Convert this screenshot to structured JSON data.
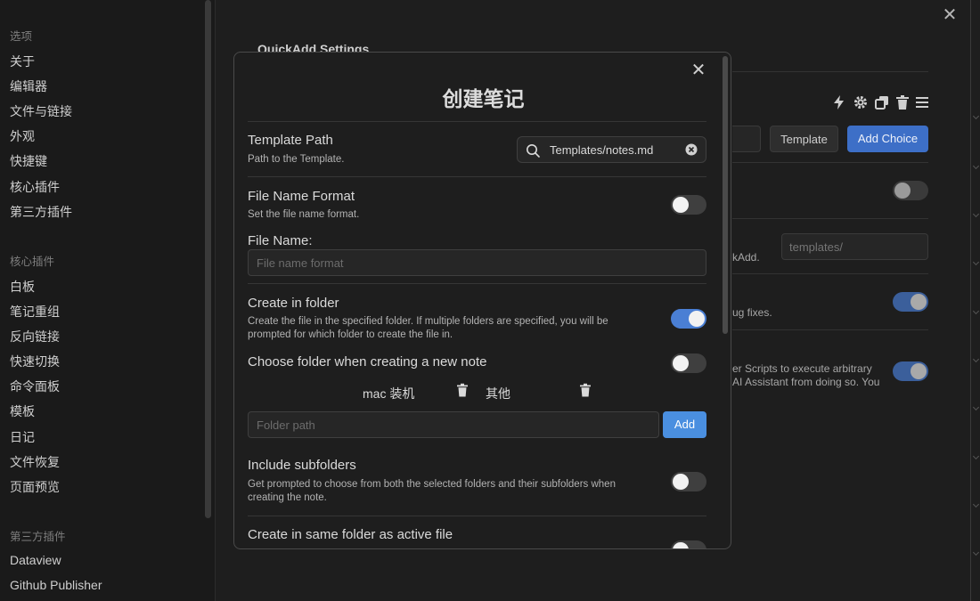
{
  "sidebar": {
    "options_heading": "选项",
    "options_items": [
      "关于",
      "编辑器",
      "文件与链接",
      "外观",
      "快捷键",
      "核心插件",
      "第三方插件"
    ],
    "core_heading": "核心插件",
    "core_items": [
      "白板",
      "笔记重组",
      "反向链接",
      "快速切换",
      "命令面板",
      "模板",
      "日记",
      "文件恢复",
      "页面预览"
    ],
    "third_heading": "第三方插件",
    "third_items": [
      "Dataview",
      "Github Publisher"
    ]
  },
  "background": {
    "title": "QuickAdd Settings",
    "template_button": "Template",
    "add_choice_button": "Add Choice",
    "templates_placeholder": "templates/",
    "frag_quickadd": "kAdd.",
    "frag_bugfixes": "ug fixes.",
    "frag_scripts_1": "er Scripts to execute arbitrary",
    "frag_scripts_2": "AI Assistant from doing so. You",
    "icons": [
      "lightning-icon",
      "gear-icon",
      "duplicate-icon",
      "trash-icon",
      "menu-icon"
    ],
    "toggles": [
      false,
      true,
      true
    ]
  },
  "modal": {
    "title": "创建笔记",
    "template_path": {
      "name": "Template Path",
      "desc": "Path to the Template.",
      "value": "Templates/notes.md"
    },
    "file_name_format": {
      "name": "File Name Format",
      "desc": "Set the file name format.",
      "enabled": false
    },
    "file_name": {
      "label": "File Name:",
      "placeholder": "File name format"
    },
    "create_in_folder": {
      "name": "Create in folder",
      "desc": "Create the file in the specified folder. If multiple folders are specified, you will be prompted for which folder to create the file in.",
      "enabled": true
    },
    "choose_folder": {
      "name": "Choose folder when creating a new note",
      "enabled": false
    },
    "folders": [
      "mac 装机",
      "其他"
    ],
    "folder_path": {
      "placeholder": "Folder path",
      "add_label": "Add"
    },
    "include_subfolders": {
      "name": "Include subfolders",
      "desc": "Get prompted to choose from both the selected folders and their subfolders when creating the note.",
      "enabled": false
    },
    "same_folder": {
      "name": "Create in same folder as active file",
      "enabled": false
    }
  },
  "colors": {
    "accent": "#4a7fd4",
    "add_button": "#4a8fe0",
    "background": "#1e1e1e"
  }
}
